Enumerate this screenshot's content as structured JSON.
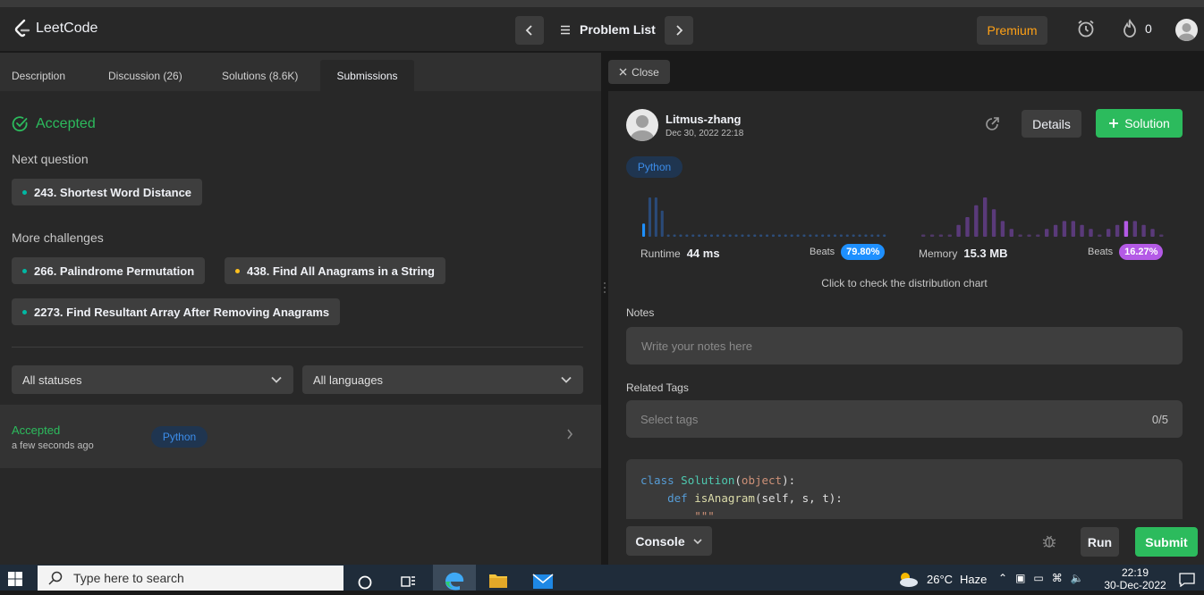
{
  "app": {
    "name": "LeetCode"
  },
  "navbar": {
    "problem_list": "Problem List",
    "premium": "Premium",
    "streak": "0"
  },
  "left_tabs": [
    "Description",
    "Discussion (26)",
    "Solutions (8.6K)",
    "Submissions"
  ],
  "result": {
    "status": "Accepted",
    "next_question_title": "Next question",
    "next_question": "243. Shortest Word Distance",
    "more_challenges_title": "More challenges",
    "challenges": [
      "266. Palindrome Permutation",
      "438. Find All Anagrams in a String",
      "2273. Find Resultant Array After Removing Anagrams"
    ]
  },
  "filters": {
    "status": "All statuses",
    "language": "All languages"
  },
  "submission": {
    "status": "Accepted",
    "time": "a few seconds ago",
    "language": "Python"
  },
  "panel": {
    "close": "Close",
    "username": "Litmus-zhang",
    "date": "Dec 30, 2022 22:18",
    "details": "Details",
    "solution": "Solution",
    "language": "Python",
    "runtime_label": "Runtime",
    "runtime_value": "44 ms",
    "runtime_beats_label": "Beats",
    "runtime_beats": "79.80%",
    "memory_label": "Memory",
    "memory_value": "15.3 MB",
    "memory_beats_label": "Beats",
    "memory_beats": "16.27%",
    "distribution_hint": "Click to check the distribution chart",
    "notes_label": "Notes",
    "notes_placeholder": "Write your notes here",
    "tags_label": "Related Tags",
    "tags_placeholder": "Select tags",
    "tags_count": "0/5"
  },
  "code": {
    "line1_kw": "class",
    "line1_cls": "Solution",
    "line1_arg": "object",
    "line2_kw": "def",
    "line2_fn": "isAnagram",
    "line2_args": "(self, s, t):",
    "line3": "\"\"\""
  },
  "console": {
    "console": "Console",
    "run": "Run",
    "submit": "Submit"
  },
  "taskbar": {
    "search_placeholder": "Type here to search",
    "temperature": "26°C",
    "weather": "Haze",
    "time": "22:19",
    "date": "30-Dec-2022"
  },
  "colors": {
    "accent_green": "#2cbb5d",
    "premium_orange": "#ffa116",
    "runtime_blue": "#1e90ff",
    "memory_purple": "#b45ae6"
  },
  "chart_data": [
    {
      "type": "bar",
      "name": "runtime-distribution",
      "values": [
        4,
        12,
        12,
        8,
        1,
        1,
        1,
        1,
        1,
        1,
        1,
        1,
        1,
        1,
        1,
        1,
        1,
        1,
        1,
        1,
        1,
        1,
        1,
        1,
        1,
        1,
        1,
        1,
        1,
        1,
        1,
        1,
        1,
        1,
        1,
        1,
        1,
        1,
        1,
        1
      ],
      "highlight_index": 0
    },
    {
      "type": "bar",
      "name": "memory-distribution",
      "values": [
        1,
        1,
        1,
        1,
        3,
        5,
        8,
        10,
        7,
        4,
        2,
        1,
        1,
        1,
        2,
        3,
        4,
        4,
        3,
        2,
        1,
        2,
        3,
        4,
        4,
        3,
        2,
        1
      ],
      "highlight_index": 23
    }
  ]
}
